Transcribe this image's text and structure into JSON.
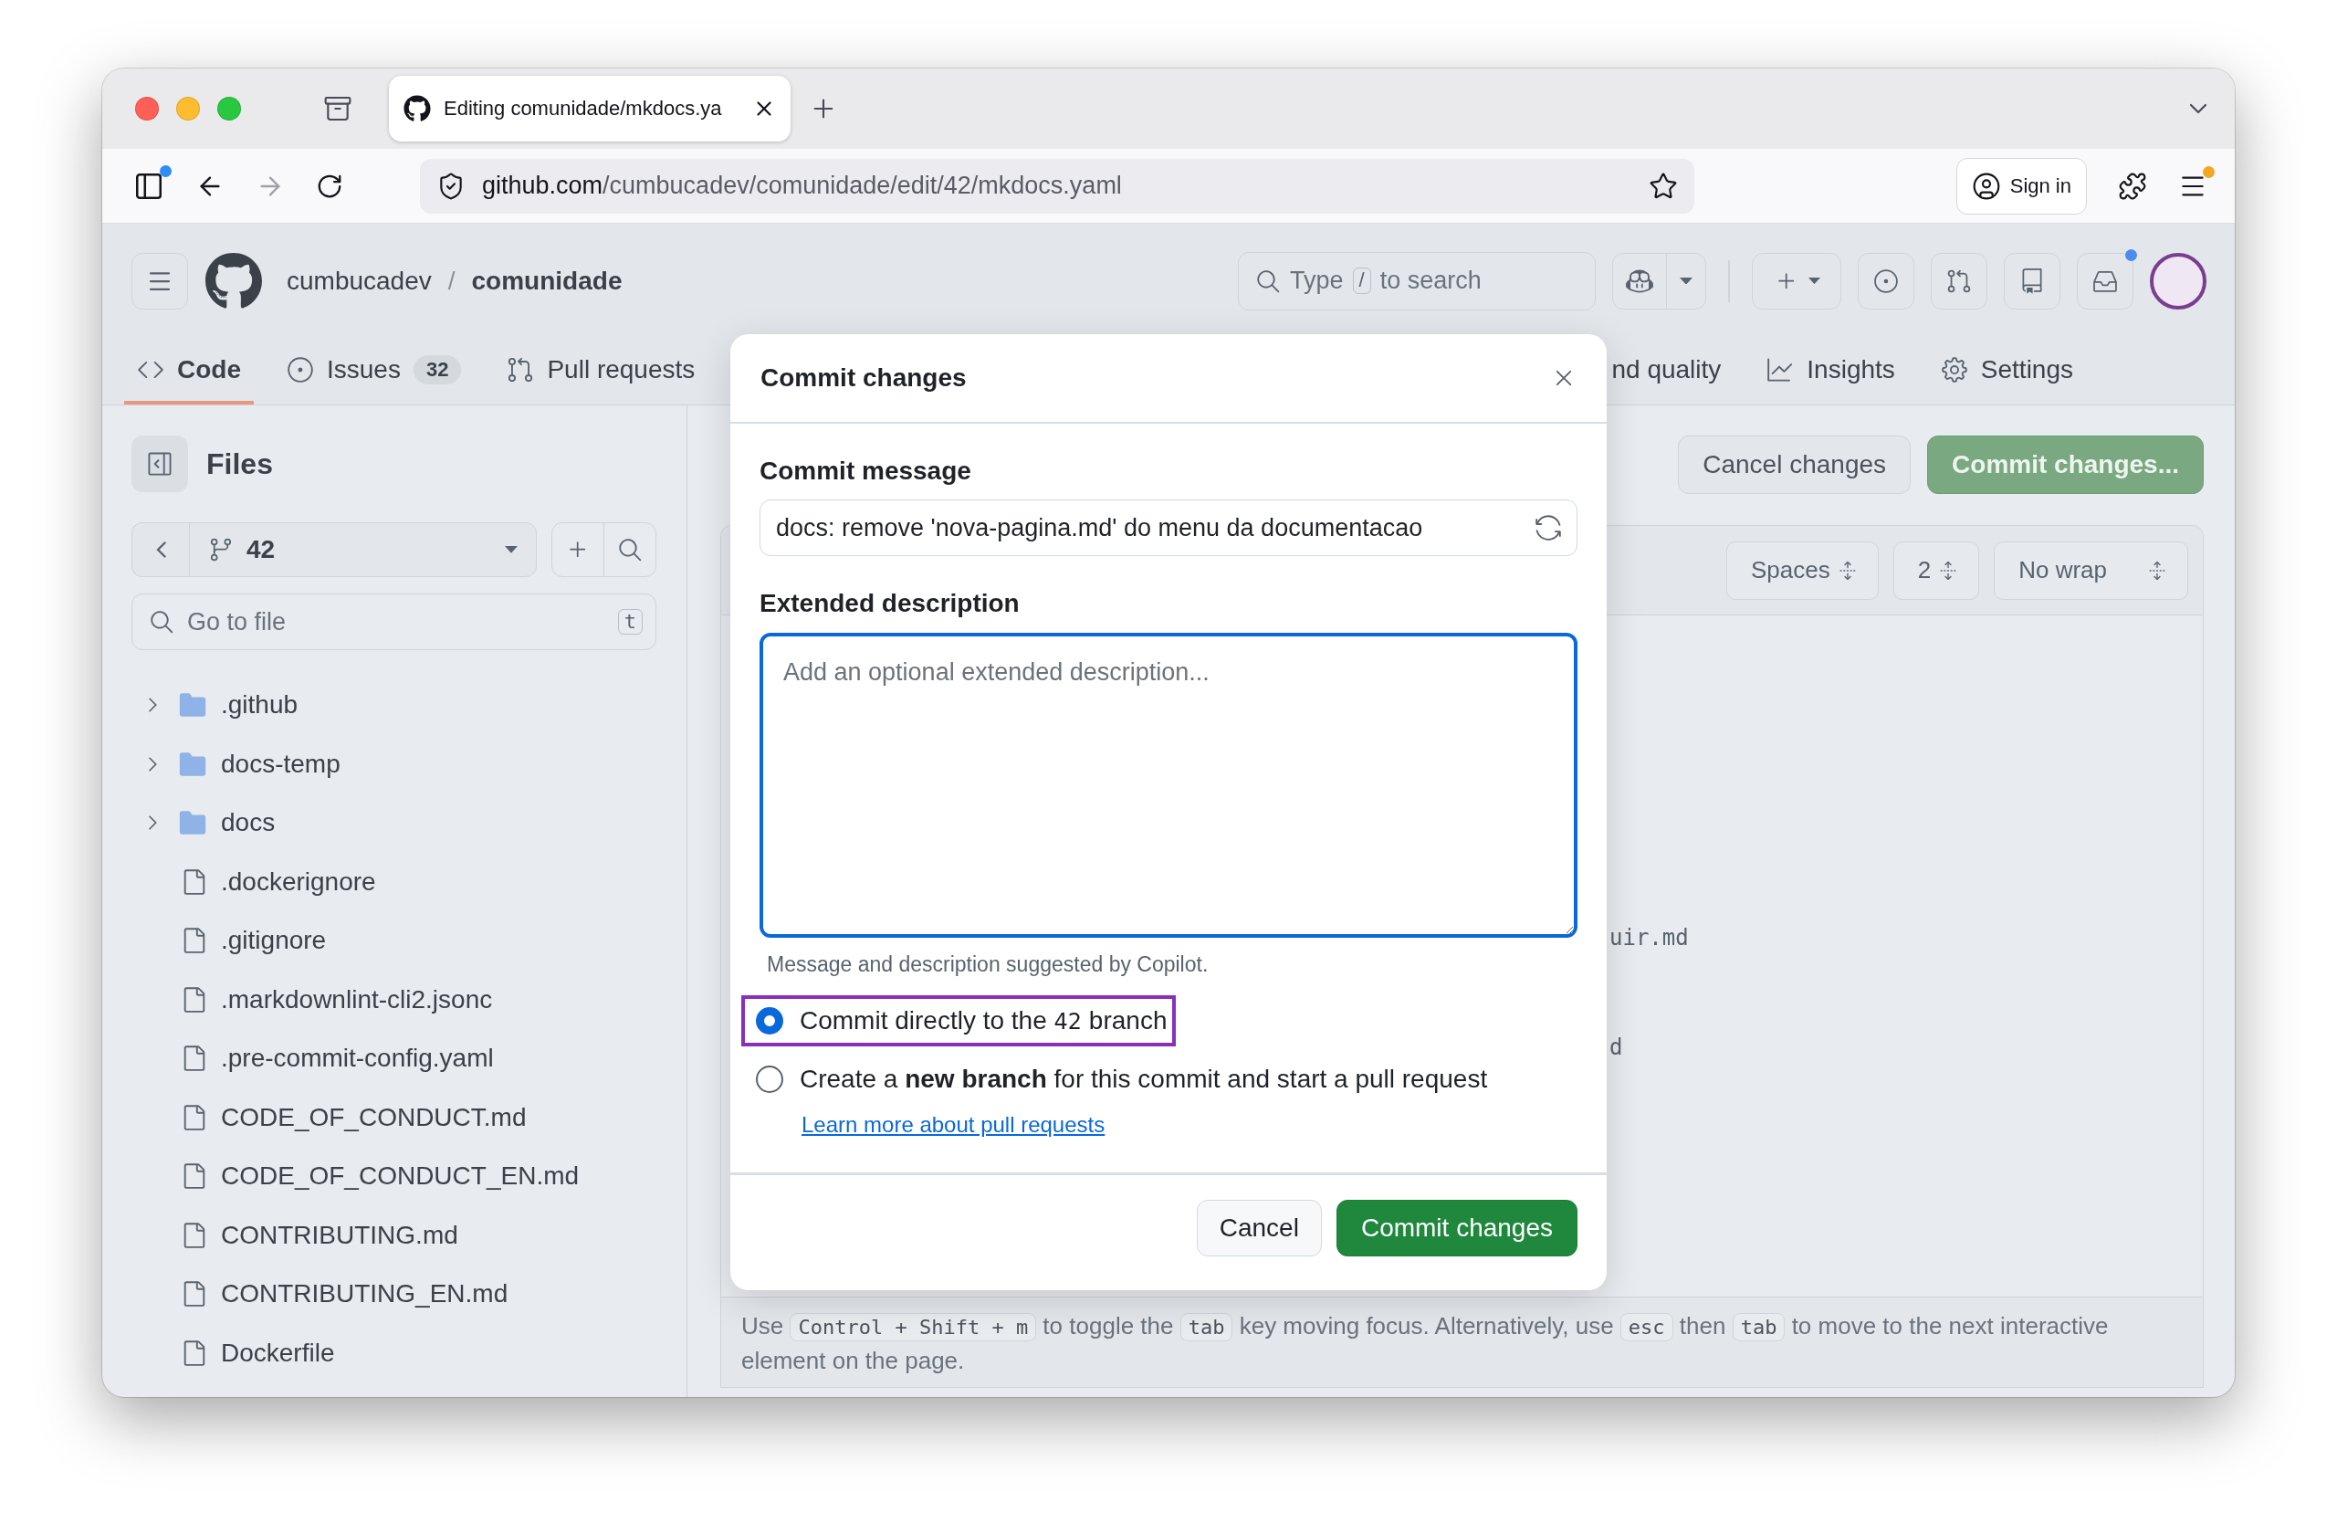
{
  "browser": {
    "tabs": [
      {
        "title": "Editing comunidade/mkdocs.ya",
        "selected": true
      }
    ],
    "url": {
      "host": "github.com",
      "path": "/cumbucadev/comunidade/edit/42/mkdocs.yaml"
    },
    "sign_in": "Sign in"
  },
  "repo": {
    "owner": "cumbucadev",
    "separator": "/",
    "name": "comunidade"
  },
  "search": {
    "prefix": "Type",
    "key": "/",
    "suffix": "to search"
  },
  "nav": [
    {
      "label": "Code",
      "selected": true
    },
    {
      "label": "Issues",
      "count": "32",
      "selected": false
    },
    {
      "label": "Pull requests",
      "selected": false
    },
    {
      "label": "nd quality",
      "selected": false
    },
    {
      "label": "Insights",
      "selected": false
    },
    {
      "label": "Settings",
      "selected": false
    }
  ],
  "sidebar": {
    "title": "Files",
    "branch": "42",
    "filter": {
      "placeholder": "Go to file",
      "key": "t"
    },
    "items": [
      {
        "kind": "folder",
        "name": ".github",
        "expanded": false
      },
      {
        "kind": "folder",
        "name": "docs-temp",
        "expanded": false
      },
      {
        "kind": "folder",
        "name": "docs",
        "expanded": false
      },
      {
        "kind": "file",
        "name": ".dockerignore"
      },
      {
        "kind": "file",
        "name": ".gitignore"
      },
      {
        "kind": "file",
        "name": ".markdownlint-cli2.jsonc"
      },
      {
        "kind": "file",
        "name": ".pre-commit-config.yaml"
      },
      {
        "kind": "file",
        "name": "CODE_OF_CONDUCT.md"
      },
      {
        "kind": "file",
        "name": "CODE_OF_CONDUCT_EN.md"
      },
      {
        "kind": "file",
        "name": "CONTRIBUTING.md"
      },
      {
        "kind": "file",
        "name": "CONTRIBUTING_EN.md"
      },
      {
        "kind": "file",
        "name": "Dockerfile"
      }
    ]
  },
  "main": {
    "cancel": "Cancel changes",
    "commit": "Commit changes...",
    "selects": [
      "Spaces",
      "2",
      "No wrap"
    ],
    "code_lines": [
      {
        "text": "uir.md"
      },
      {
        "text": "d"
      }
    ],
    "hint": [
      {
        "kind": "text",
        "text": "Use "
      },
      {
        "kind": "key",
        "text": "Control + Shift + m"
      },
      {
        "kind": "text",
        "text": " to toggle the "
      },
      {
        "kind": "key",
        "text": "tab"
      },
      {
        "kind": "text",
        "text": " key moving focus. Alternatively, use "
      },
      {
        "kind": "key",
        "text": "esc"
      },
      {
        "kind": "text",
        "text": " then "
      },
      {
        "kind": "key",
        "text": "tab"
      },
      {
        "kind": "text",
        "text": " to move to the next interactive element on the page."
      }
    ]
  },
  "dialog": {
    "title": "Commit changes",
    "message": {
      "label": "Commit message",
      "value": "docs: remove 'nova-pagina.md' do menu da documentacao"
    },
    "description": {
      "label": "Extended description",
      "placeholder": "Add an optional extended description...",
      "focused": true
    },
    "note": "Message and description suggested by Copilot.",
    "options": [
      {
        "kind": "direct",
        "label": "Commit directly to the",
        "branch": "42",
        "label_after": "branch",
        "selected": true,
        "focused": true
      },
      {
        "kind": "new",
        "label": "Create a **new branch** for this commit and start a pull request",
        "link": "Learn more about pull requests",
        "selected": false,
        "focused": false
      }
    ],
    "cancel": "Cancel",
    "submit": "Commit changes"
  }
}
